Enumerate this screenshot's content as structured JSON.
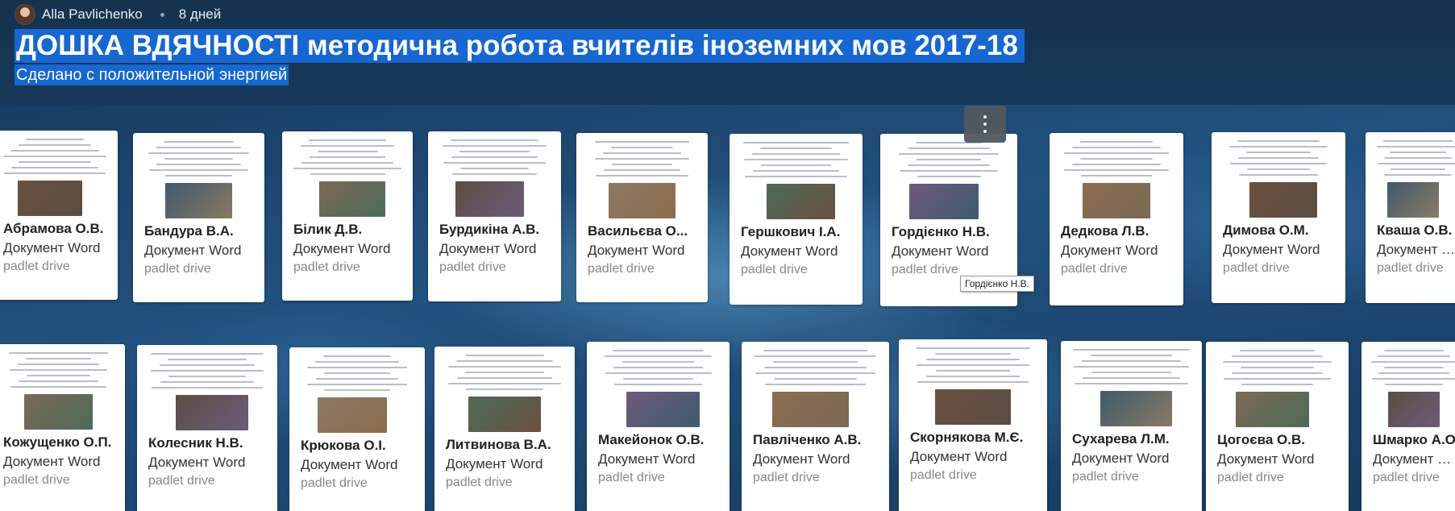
{
  "header": {
    "author": "Alla Pavlichenko",
    "time_ago": "8 дней",
    "title": "ДОШКА ВДЯЧНОСТІ методична робота вчителів іноземних мов 2017-18",
    "subtitle": "Сделано с положительной энергией"
  },
  "tooltip": "Гордієнко Н.В.",
  "cards": [
    {
      "title": "Абрамова О.В.",
      "type": "Документ Word",
      "source": "padlet drive"
    },
    {
      "title": "Бандура В.А.",
      "type": "Документ Word",
      "source": "padlet drive"
    },
    {
      "title": "Білик Д.В.",
      "type": "Документ Word",
      "source": "padlet drive"
    },
    {
      "title": "Бурдикіна А.В.",
      "type": "Документ Word",
      "source": "padlet drive"
    },
    {
      "title": "Васильєва О...",
      "type": "Документ Word",
      "source": "padlet drive"
    },
    {
      "title": "Гершкович І.А.",
      "type": "Документ Word",
      "source": "padlet drive"
    },
    {
      "title": "Гордієнко Н.В.",
      "type": "Документ Word",
      "source": "padlet drive"
    },
    {
      "title": "Дедкова Л.В.",
      "type": "Документ Word",
      "source": "padlet drive"
    },
    {
      "title": "Димова О.М.",
      "type": "Документ Word",
      "source": "padlet drive"
    },
    {
      "title": "Кваша О.В.",
      "type": "Документ Word",
      "source": "padlet drive"
    },
    {
      "title": "Кожущенко О.П.",
      "type": "Документ Word",
      "source": "padlet drive"
    },
    {
      "title": "Колесник Н.В.",
      "type": "Документ Word",
      "source": "padlet drive"
    },
    {
      "title": "Крюкова О.І.",
      "type": "Документ Word",
      "source": "padlet drive"
    },
    {
      "title": "Литвинова В.А.",
      "type": "Документ Word",
      "source": "padlet drive"
    },
    {
      "title": "Макейонок О.В.",
      "type": "Документ Word",
      "source": "padlet drive"
    },
    {
      "title": "Павліченко А.В.",
      "type": "Документ Word",
      "source": "padlet drive"
    },
    {
      "title": "Скорнякова М.Є.",
      "type": "Документ Word",
      "source": "padlet drive"
    },
    {
      "title": "Сухарева Л.М.",
      "type": "Документ Word",
      "source": "padlet drive"
    },
    {
      "title": "Цогоєва О.В.",
      "type": "Документ Word",
      "source": "padlet drive"
    },
    {
      "title": "Шмарко А.О.",
      "type": "Документ Word",
      "source": "padlet drive"
    }
  ]
}
